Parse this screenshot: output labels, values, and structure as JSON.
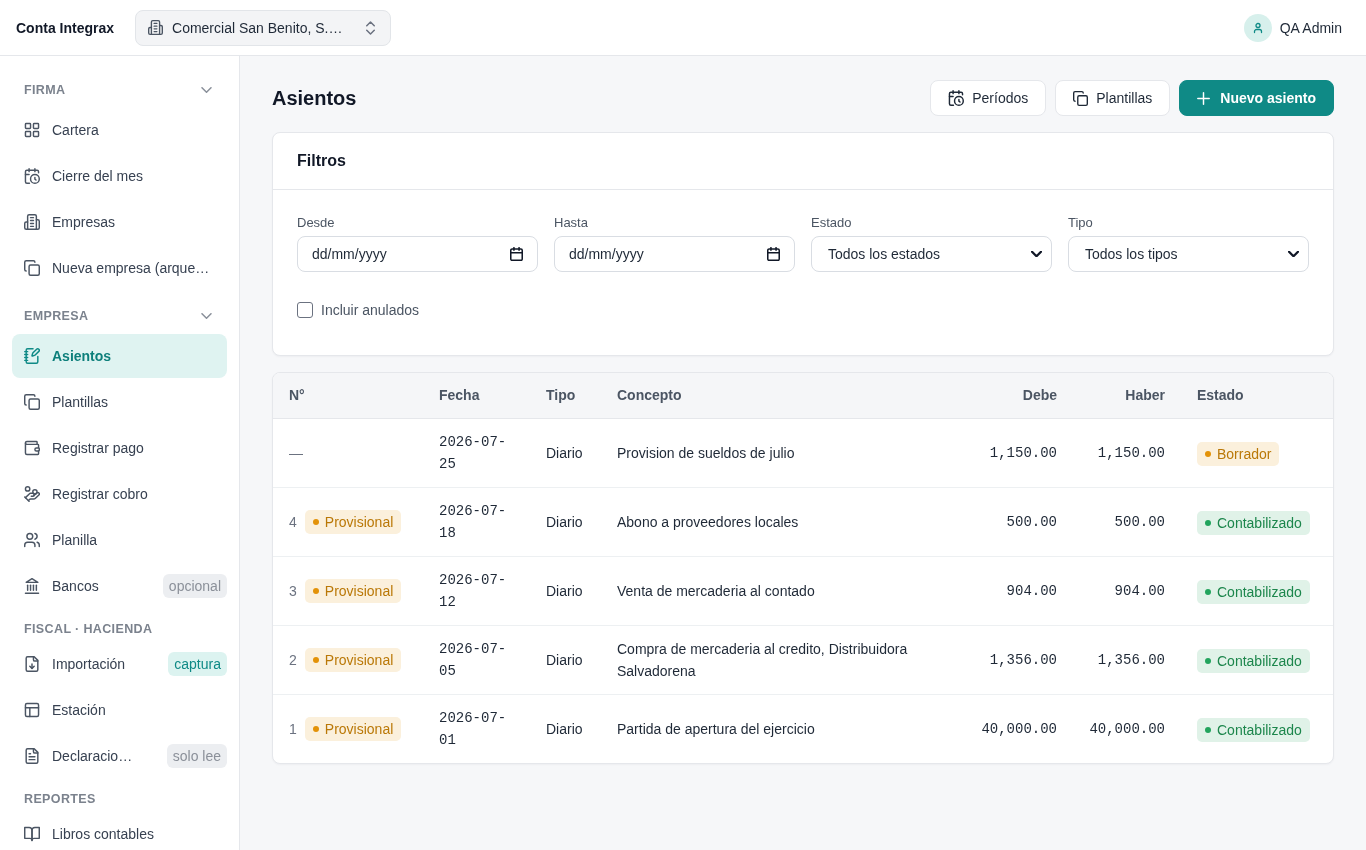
{
  "app": {
    "name": "Conta Integrax"
  },
  "company_selector": {
    "value": "Comercial San Benito, S.…"
  },
  "user": {
    "name": "QA Admin"
  },
  "sidebar": {
    "sections": [
      {
        "title": "FIRMA",
        "collapsible": true,
        "items": [
          {
            "label": "Cartera",
            "selected": false
          },
          {
            "label": "Cierre del mes",
            "selected": false
          },
          {
            "label": "Empresas",
            "selected": false
          },
          {
            "label": "Nueva empresa (arque…",
            "selected": false
          }
        ]
      },
      {
        "title": "EMPRESA",
        "collapsible": true,
        "items": [
          {
            "label": "Asientos",
            "selected": true
          },
          {
            "label": "Plantillas",
            "selected": false
          },
          {
            "label": "Registrar pago",
            "selected": false
          },
          {
            "label": "Registrar cobro",
            "selected": false
          },
          {
            "label": "Planilla",
            "selected": false
          },
          {
            "label": "Bancos",
            "selected": false,
            "note": {
              "text": "opcional",
              "kind": "neutral"
            }
          }
        ]
      },
      {
        "title": "FISCAL · HACIENDA",
        "collapsible": false,
        "items": [
          {
            "label": "Importación",
            "selected": false,
            "note": {
              "text": "captura",
              "kind": "accent"
            }
          },
          {
            "label": "Estación",
            "selected": false
          },
          {
            "label": "Declaracio…",
            "selected": false,
            "note": {
              "text": "solo lee",
              "kind": "neutral"
            }
          }
        ]
      },
      {
        "title": "REPORTES",
        "collapsible": false,
        "items": [
          {
            "label": "Libros contables",
            "selected": false
          }
        ]
      }
    ]
  },
  "page": {
    "title": "Asientos",
    "actions": [
      {
        "label": "Períodos",
        "kind": "secondary"
      },
      {
        "label": "Plantillas",
        "kind": "secondary"
      },
      {
        "label": "Nuevo asiento",
        "kind": "primary"
      }
    ]
  },
  "filters": {
    "title": "Filtros",
    "fields": [
      {
        "label": "Desde",
        "kind": "date",
        "placeholder": "dd/mm/yyyy"
      },
      {
        "label": "Hasta",
        "kind": "date",
        "placeholder": "dd/mm/yyyy"
      },
      {
        "label": "Estado",
        "kind": "select",
        "value": "Todos los estados"
      },
      {
        "label": "Tipo",
        "kind": "select",
        "value": "Todos los tipos"
      }
    ],
    "include_voided": {
      "label": "Incluir anulados",
      "checked": false
    }
  },
  "table": {
    "columns": [
      {
        "label": "N°",
        "kind": "number"
      },
      {
        "label": "Fecha",
        "kind": "date"
      },
      {
        "label": "Tipo",
        "kind": "text"
      },
      {
        "label": "Concepto",
        "kind": "text"
      },
      {
        "label": "Debe",
        "kind": "amount"
      },
      {
        "label": "Haber",
        "kind": "amount"
      },
      {
        "label": "Estado",
        "kind": "status"
      }
    ],
    "rows": [
      {
        "cells": [
          {
            "text": "—"
          },
          "2026-07-25",
          "Diario",
          "Provision de sueldos de julio",
          "1,150.00",
          "1,150.00",
          {
            "text": "Borrador",
            "color": "#e39208"
          }
        ]
      },
      {
        "cells": [
          {
            "text": "4",
            "tag": {
              "text": "Provisional",
              "color": "#e39208"
            }
          },
          "2026-07-18",
          "Diario",
          "Abono a proveedores locales",
          "500.00",
          "500.00",
          {
            "text": "Contabilizado",
            "color": "#22a45d"
          }
        ]
      },
      {
        "cells": [
          {
            "text": "3",
            "tag": {
              "text": "Provisional",
              "color": "#e39208"
            }
          },
          "2026-07-12",
          "Diario",
          "Venta de mercaderia al contado",
          "904.00",
          "904.00",
          {
            "text": "Contabilizado",
            "color": "#22a45d"
          }
        ]
      },
      {
        "cells": [
          {
            "text": "2",
            "tag": {
              "text": "Provisional",
              "color": "#e39208"
            }
          },
          "2026-07-05",
          "Diario",
          "Compra de mercaderia al credito, Distribuidora Salvadorena",
          "1,356.00",
          "1,356.00",
          {
            "text": "Contabilizado",
            "color": "#22a45d"
          }
        ]
      },
      {
        "cells": [
          {
            "text": "1",
            "tag": {
              "text": "Provisional",
              "color": "#e39208"
            }
          },
          "2026-07-01",
          "Diario",
          "Partida de apertura del ejercicio",
          "40,000.00",
          "40,000.00",
          {
            "text": "Contabilizado",
            "color": "#22a45d"
          }
        ]
      }
    ]
  }
}
